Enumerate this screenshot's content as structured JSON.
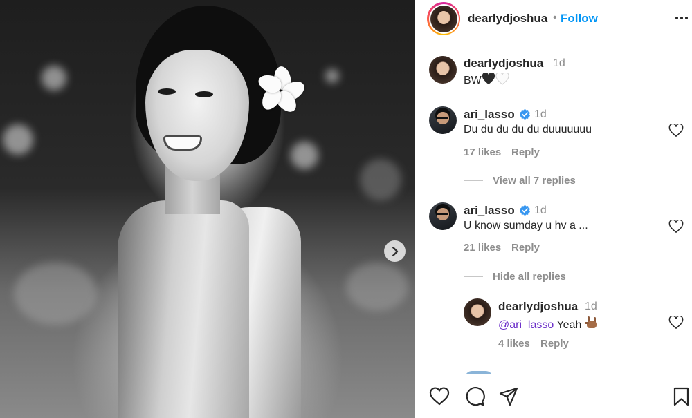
{
  "post": {
    "author": "dearlydjoshua",
    "separator": "•",
    "follow_label": "Follow",
    "photo_alt": "Black and white portrait of a smiling woman with a flower in her hair",
    "next_icon": "chevron-right-icon"
  },
  "comments": [
    {
      "user": "dearlydjoshua",
      "time": "1d",
      "text": "BW",
      "emoji": [
        "black-heart",
        "white-heart"
      ],
      "verified": false
    },
    {
      "user": "ari_lasso",
      "time": "1d",
      "text": "Du du du du du duuuuuuu",
      "likes": "17 likes",
      "reply_label": "Reply",
      "verified": true,
      "replies_toggle": "View all 7 replies"
    },
    {
      "user": "ari_lasso",
      "time": "1d",
      "text": "U know sumday u hv a ...",
      "likes": "21 likes",
      "reply_label": "Reply",
      "verified": true,
      "replies_toggle": "Hide all replies"
    }
  ],
  "replies": [
    {
      "user": "dearlydjoshua",
      "time": "1d",
      "mention": "@ari_lasso",
      "text": " Yeah",
      "emoji": [
        "sign-of-the-horns"
      ],
      "likes": "4 likes",
      "reply_label": "Reply"
    }
  ],
  "actions": {
    "icons": [
      "heart-icon",
      "comment-icon",
      "share-icon",
      "bookmark-icon"
    ]
  },
  "colors": {
    "follow": "#0095f6",
    "secondary_text": "#8e8e8e",
    "mention": "#6c2fc9",
    "verified": "#3897f0"
  }
}
